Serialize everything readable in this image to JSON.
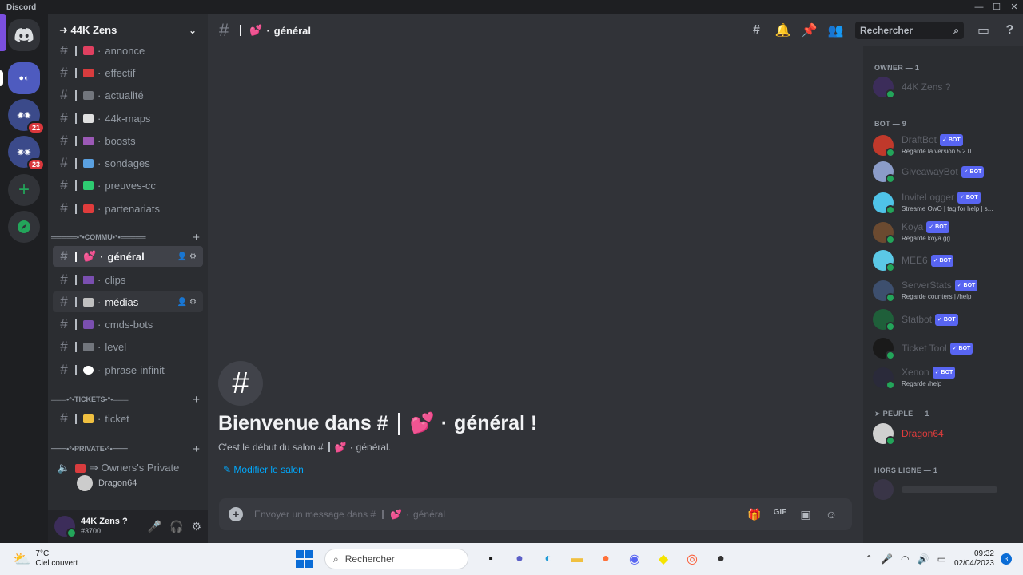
{
  "window": {
    "title": "Discord"
  },
  "server": {
    "name": "➜ 44K Zens"
  },
  "guilds": {
    "badge_1": "21",
    "badge_2": "23"
  },
  "channels": [
    {
      "name": "annonce",
      "color": "#e04060"
    },
    {
      "name": "effectif",
      "color": "#d83c3e"
    },
    {
      "name": "actualité",
      "color": "#72767d"
    },
    {
      "name": "44k-maps",
      "color": "#ffffff"
    },
    {
      "name": "boosts",
      "color": "#9b59b6"
    },
    {
      "name": "sondages",
      "color": "#5aa0e0"
    },
    {
      "name": "preuves-cc",
      "color": "#2ecc71"
    },
    {
      "name": "partenariats",
      "color": "#e03c3c"
    }
  ],
  "categories": {
    "commu": "═════•°•COMMU•°•═════",
    "tickets": "═══•°•TICKETS•°•═══",
    "private": "═══•°•PRIVATE•°•═══"
  },
  "commu_channels": [
    {
      "name": "général",
      "color": "#e8478b"
    },
    {
      "name": "clips",
      "color": "#7a4fb0"
    },
    {
      "name": "médias",
      "color": "#c0c0c0"
    },
    {
      "name": "cmds-bots",
      "color": "#7a4fb0"
    },
    {
      "name": "level",
      "color": "#72767d"
    },
    {
      "name": "phrase-infinit",
      "color": "#ffffff"
    }
  ],
  "tickets_channels": [
    {
      "name": "ticket",
      "color": "#f0c040"
    }
  ],
  "private_channels": [
    {
      "name": "⇒ Owners's Private"
    }
  ],
  "voice_user": "Dragon64",
  "user": {
    "name": "44K Zens ?",
    "tag": "#3700"
  },
  "header": {
    "channel": "général",
    "search_placeholder": "Rechercher"
  },
  "welcome": {
    "title_prefix": "Bienvenue dans #",
    "title_channel": "général !",
    "subtitle_prefix": "C'est le début du salon #",
    "subtitle_channel": "général.",
    "edit_link": "Modifier le salon"
  },
  "composer": {
    "placeholder_prefix": "Envoyer un message dans #",
    "placeholder_channel": "général",
    "gif_label": "GIF"
  },
  "members": {
    "groups": {
      "owner": "OWNER — 1",
      "bot": "BOT — 9",
      "people": "➤ PEUPLE — 1",
      "offline": "HORS LIGNE — 1"
    },
    "bot_label": "✓ BOT",
    "owner": [
      {
        "name": "44K Zens ?",
        "status": ""
      }
    ],
    "bots": [
      {
        "name": "DraftBot",
        "status": "Regarde la version 5.2.0",
        "color": "#c0392b"
      },
      {
        "name": "GiveawayBot",
        "status": "",
        "color": "#8b9cc8"
      },
      {
        "name": "InviteLogger",
        "status": "Streame OwO | tag for help | s...",
        "color": "#4fc3e8"
      },
      {
        "name": "Koya",
        "status": "Regarde koya.gg",
        "color": "#6b4a30"
      },
      {
        "name": "MEE6",
        "status": "",
        "color": "#5bc8e6"
      },
      {
        "name": "ServerStats",
        "status": "Regarde counters | /help",
        "color": "#3d4f6e"
      },
      {
        "name": "Statbot",
        "status": "",
        "color": "#1f5f3a"
      },
      {
        "name": "Ticket Tool",
        "status": "",
        "color": "#1a1a1a"
      },
      {
        "name": "Xenon",
        "status": "Regarde /help",
        "color": "#2a2a3a"
      }
    ],
    "people": [
      {
        "name": "Dragon64",
        "color": "#e03c3c"
      }
    ]
  },
  "taskbar": {
    "temp": "7°C",
    "weather": "Ciel couvert",
    "search": "Rechercher",
    "time": "09:32",
    "date": "02/04/2023",
    "notifications": "3"
  }
}
